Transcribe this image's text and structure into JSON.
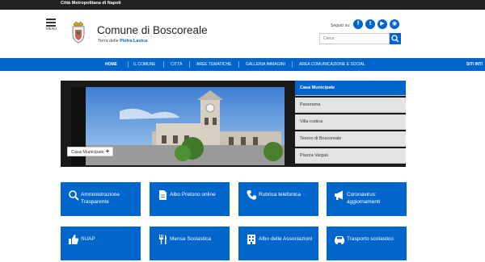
{
  "topbar": {
    "label": "Città Metropolitana di Napoli"
  },
  "header": {
    "menu_label": "MENU",
    "title": "Comune di Boscoreale",
    "subtitle_prefix": "Terra delle ",
    "subtitle_highlight": "Pietra Lavica",
    "follow_label": "Seguici su:",
    "social": [
      {
        "icon": "facebook-icon",
        "glyph": "f"
      },
      {
        "icon": "twitter-icon",
        "glyph": "t"
      },
      {
        "icon": "youtube-icon",
        "glyph": "▶"
      },
      {
        "icon": "rss-icon",
        "glyph": "◉"
      }
    ],
    "search_placeholder": "Cerca"
  },
  "nav": {
    "items": [
      "HOME",
      "IL COMUNE",
      "CITTÀ",
      "AREE TEMATICHE",
      "GALLERIA IMMAGINI",
      "AREA COMUNICAZIONE E SOCIAL",
      "SITI INTI"
    ]
  },
  "slider": {
    "caption": "Casa Municipale",
    "caption_plus": "+",
    "items": [
      "Casa Municipale",
      "Panorama",
      "Villa rustica",
      "Tesoro di Boscoreale",
      "Piazza Vargas"
    ],
    "active_index": 0
  },
  "tiles": [
    {
      "label": "Amministrazione Trasparente",
      "icon": "search-icon"
    },
    {
      "label": "Albo Pretorio online",
      "icon": "document-icon"
    },
    {
      "label": "Rubrica telefonica",
      "icon": "phone-icon"
    },
    {
      "label": "Coronavirus: aggiornamenti",
      "icon": "megaphone-icon"
    },
    {
      "label": "SUAP",
      "icon": "thumbs-up-icon"
    },
    {
      "label": "Mensa Scolastica",
      "icon": "cutlery-icon"
    },
    {
      "label": "Albo delle Associazioni",
      "icon": "building-icon"
    },
    {
      "label": "Trasporto scolastico",
      "icon": "car-icon"
    }
  ],
  "colors": {
    "primary": "#0066cc",
    "topbar": "#222222",
    "slider_bg": "#1a1a1a"
  }
}
